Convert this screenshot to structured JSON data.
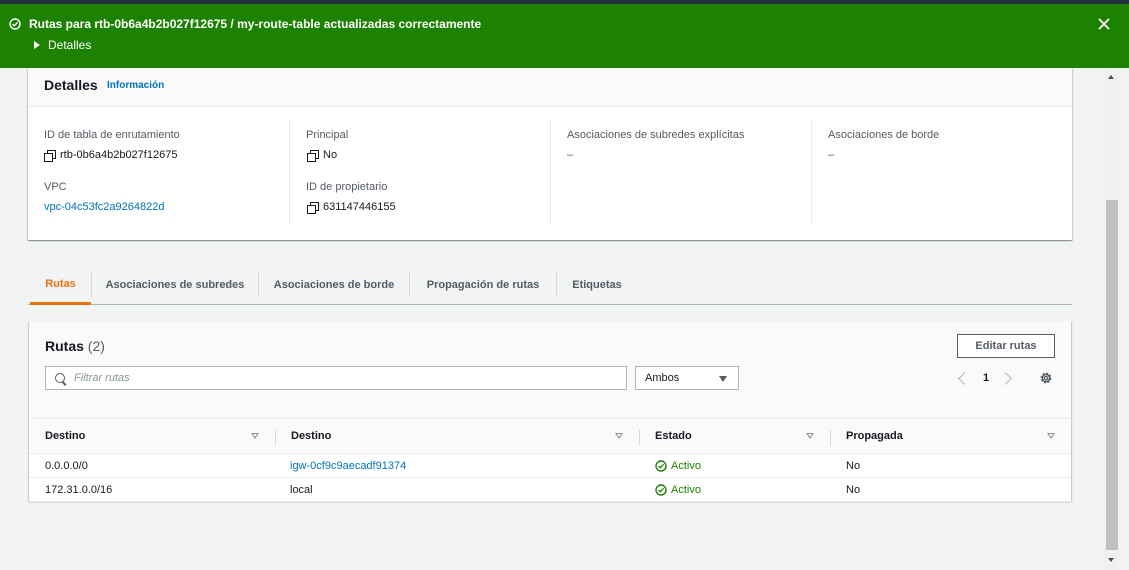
{
  "flash": {
    "message": "Rutas para rtb-0b6a4b2b027f12675 / my-route-table actualizadas correctamente",
    "details_label": "Detalles",
    "color": "#1d8102"
  },
  "details": {
    "title": "Detalles",
    "info_link": "Información",
    "route_table_id_label": "ID de tabla de enrutamiento",
    "route_table_id": "rtb-0b6a4b2b027f12675",
    "vpc_label": "VPC",
    "vpc": "vpc-04c53fc2a9264822d",
    "main_label": "Principal",
    "main": "No",
    "owner_label": "ID de propietario",
    "owner": "631147446155",
    "subnet_assoc_label": "Asociaciones de subredes explícitas",
    "subnet_assoc": "–",
    "edge_assoc_label": "Asociaciones de borde",
    "edge_assoc": "–"
  },
  "tabs": [
    {
      "label": "Rutas",
      "active": true
    },
    {
      "label": "Asociaciones de subredes"
    },
    {
      "label": "Asociaciones de borde"
    },
    {
      "label": "Propagación de rutas"
    },
    {
      "label": "Etiquetas"
    }
  ],
  "routes": {
    "title": "Rutas",
    "count": "(2)",
    "edit_button": "Editar rutas",
    "search_placeholder": "Filtrar rutas",
    "filter_value": "Ambos",
    "page": "1",
    "columns": [
      "Destino",
      "Destino",
      "Estado",
      "Propagada"
    ],
    "rows": [
      {
        "destination": "0.0.0.0/0",
        "target": "igw-0cf9c9aecadf91374",
        "status": "Activo",
        "propagated": "No"
      },
      {
        "destination": "172.31.0.0/16",
        "target": "local",
        "status": "Activo",
        "propagated": "No"
      }
    ]
  },
  "colors": {
    "accent": "#ec7211",
    "link": "#0073bb",
    "success": "#1d8102"
  }
}
